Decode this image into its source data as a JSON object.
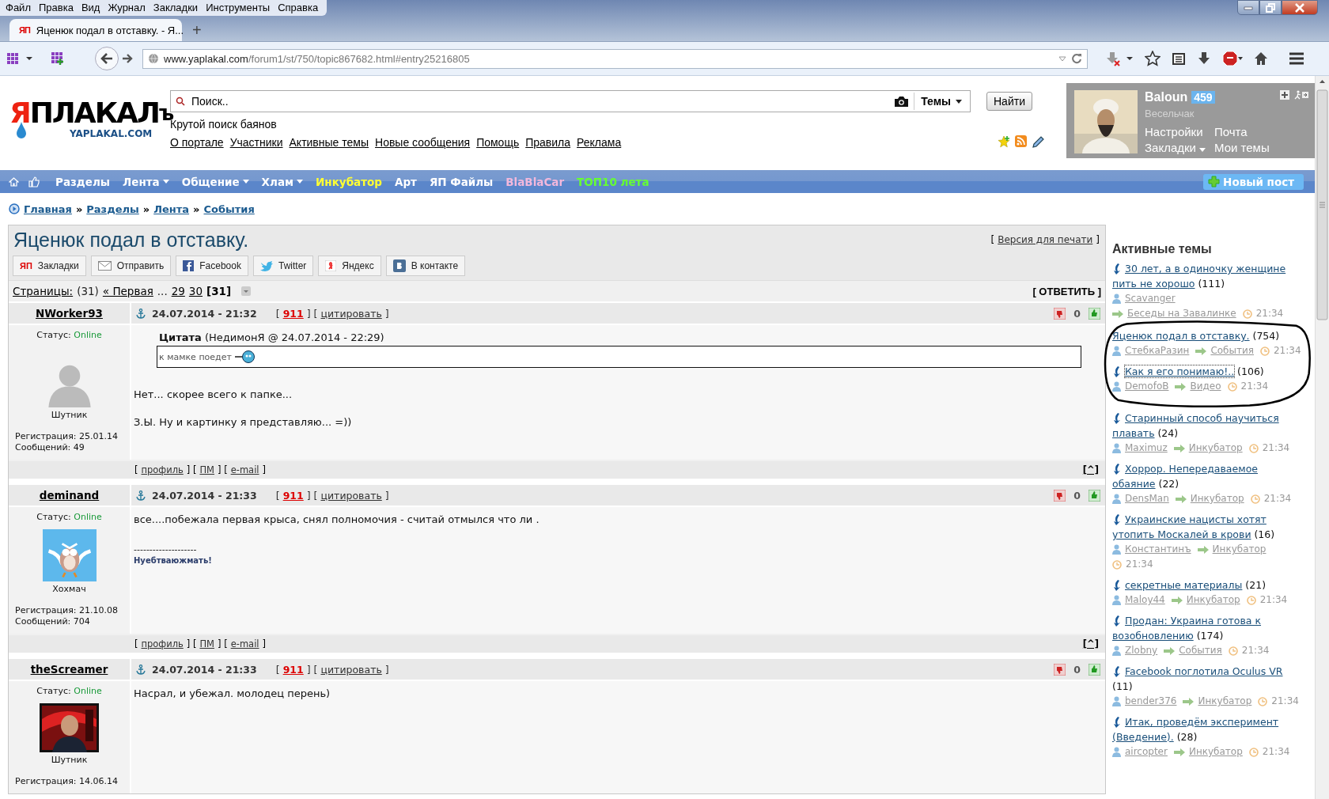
{
  "browser": {
    "menu": [
      "Файл",
      "Правка",
      "Вид",
      "Журнал",
      "Закладки",
      "Инструменты",
      "Справка"
    ],
    "tab": {
      "icon_text": "ЯП",
      "title": "Яценюк подал в отставку. - Я...",
      "new_tab": "+"
    },
    "url": {
      "host": "www.yaplakal.com",
      "path": "/forum1/st/750/topic867682.html#entry25216805"
    }
  },
  "header": {
    "logo": {
      "first": "Я",
      "rest": "ПЛАКАЛ",
      "suffix": "ъ",
      "domain": "YAPLAKAL.COM"
    },
    "search": {
      "placeholder": "Поиск..",
      "scope": "Темы",
      "button": "Найти"
    },
    "tagline": "Крутой поиск баянов",
    "links": [
      "О портале",
      "Участники",
      "Активные темы",
      "Новые сообщения",
      "Помощь",
      "Правила",
      "Реклама"
    ],
    "user": {
      "name": "Baloun",
      "karma": "459",
      "rank": "Весельчак",
      "links": [
        {
          "label": "Настройки",
          "dropdown": false
        },
        {
          "label": "Почта",
          "dropdown": false
        },
        {
          "label": "Закладки",
          "dropdown": true
        },
        {
          "label": "Мои темы",
          "dropdown": false
        }
      ]
    }
  },
  "nav": {
    "items": [
      {
        "label": "Разделы",
        "dropdown": false,
        "color": "#ffffff"
      },
      {
        "label": "Лента",
        "dropdown": true,
        "color": "#ffffff"
      },
      {
        "label": "Общение",
        "dropdown": true,
        "color": "#ffffff"
      },
      {
        "label": "Хлам",
        "dropdown": true,
        "color": "#ffffff"
      },
      {
        "label": "Инкубатор",
        "dropdown": false,
        "color": "#ffff33"
      },
      {
        "label": "Арт",
        "dropdown": false,
        "color": "#ffffff"
      },
      {
        "label": "ЯП Файлы",
        "dropdown": false,
        "color": "#ffffff"
      },
      {
        "label": "BlaBlaCar",
        "dropdown": false,
        "color": "#f2b8dc"
      },
      {
        "label": "ТОП10 лета",
        "dropdown": false,
        "color": "#66ff33"
      }
    ],
    "new_post": "Новый пост"
  },
  "breadcrumbs": [
    {
      "text": "Главная",
      "kind": "link"
    },
    {
      "text": "»",
      "kind": "plain"
    },
    {
      "text": "Разделы",
      "kind": "link"
    },
    {
      "text": "»",
      "kind": "plain"
    },
    {
      "text": "Лента",
      "kind": "link"
    },
    {
      "text": "»",
      "kind": "plain"
    },
    {
      "text": "События",
      "kind": "link"
    }
  ],
  "topic": {
    "title": "Яценюк подал в отставку.",
    "print": [
      {
        "text": "[",
        "kind": "plain"
      },
      {
        "text": "Версия для печати",
        "kind": "link"
      },
      {
        "text": "]",
        "kind": "plain"
      }
    ],
    "share": [
      {
        "kind": "bookmarks",
        "icon_text": "ЯП",
        "label": "Закладки"
      },
      {
        "kind": "mail",
        "label": "Отправить"
      },
      {
        "kind": "facebook",
        "label": "Facebook"
      },
      {
        "kind": "twitter",
        "label": "Twitter"
      },
      {
        "kind": "yandex",
        "label": "Яндекс"
      },
      {
        "kind": "vk",
        "label": "В контакте"
      }
    ],
    "pages": {
      "label": "Страницы:",
      "count": "(31)",
      "first": "« Первая",
      "gap": "...",
      "items": [
        {
          "label": "29",
          "selected": false
        },
        {
          "label": "30",
          "selected": false
        },
        {
          "label": "[31]",
          "selected": true
        }
      ]
    },
    "reply": "[ ОТВЕТИТЬ ]"
  },
  "posts": [
    {
      "author": "NWorker93",
      "date": "24.07.2014 - 21:32",
      "meta": [
        {
          "text": "[",
          "kind": "plain"
        },
        {
          "text": "911",
          "kind": "alert"
        },
        {
          "text": "] [",
          "kind": "plain"
        },
        {
          "text": "цитировать",
          "kind": "link"
        },
        {
          "text": "]",
          "kind": "plain"
        }
      ],
      "votes": "0",
      "status_label": "Статус:",
      "status": "Online",
      "avatar": {
        "kind": "placeholder"
      },
      "rank": "Шутник",
      "registration": "Регистрация: 25.01.14",
      "messages": "Сообщений: 49",
      "quote": {
        "header": "**Цитата** (НедимонЯ @ 24.07.2014 - 22:29)",
        "text": "к мамке поедет"
      },
      "body": [
        "Нет... скорее всего к папке...",
        "З.Ы. Ну и картинку я представляю... =))"
      ],
      "footer": [
        {
          "text": "[",
          "kind": "plain"
        },
        {
          "text": "профиль",
          "kind": "link"
        },
        {
          "text": "] [",
          "kind": "plain"
        },
        {
          "text": "ПМ",
          "kind": "link"
        },
        {
          "text": "] [",
          "kind": "plain"
        },
        {
          "text": "e-mail",
          "kind": "link"
        },
        {
          "text": "]",
          "kind": "plain"
        }
      ],
      "up": "[^]"
    },
    {
      "author": "deminand",
      "date": "24.07.2014 - 21:33",
      "meta": [
        {
          "text": "[",
          "kind": "plain"
        },
        {
          "text": "911",
          "kind": "alert"
        },
        {
          "text": "] [",
          "kind": "plain"
        },
        {
          "text": "цитировать",
          "kind": "link"
        },
        {
          "text": "]",
          "kind": "plain"
        }
      ],
      "votes": "0",
      "status_label": "Статус:",
      "status": "Online",
      "avatar": {
        "kind": "picture"
      },
      "rank": "Хохмач",
      "registration": "Регистрация: 21.10.08",
      "messages": "Сообщений: 704",
      "body": [
        "все....побежала первая крыса, снял полномочия - считай отмылся что ли ."
      ],
      "signature": {
        "rule": "--------------------",
        "text": "Нуебтваюжмать!"
      },
      "footer": [
        {
          "text": "[",
          "kind": "plain"
        },
        {
          "text": "профиль",
          "kind": "link"
        },
        {
          "text": "] [",
          "kind": "plain"
        },
        {
          "text": "ПМ",
          "kind": "link"
        },
        {
          "text": "] [",
          "kind": "plain"
        },
        {
          "text": "e-mail",
          "kind": "link"
        },
        {
          "text": "]",
          "kind": "plain"
        }
      ],
      "up": "[^]"
    },
    {
      "author": "theScreamer",
      "date": "24.07.2014 - 21:33",
      "meta": [
        {
          "text": "[",
          "kind": "plain"
        },
        {
          "text": "911",
          "kind": "alert"
        },
        {
          "text": "] [",
          "kind": "plain"
        },
        {
          "text": "цитировать",
          "kind": "link"
        },
        {
          "text": "]",
          "kind": "plain"
        }
      ],
      "votes": "0",
      "status_label": "Статус:",
      "status": "Online",
      "avatar": {
        "kind": "picture"
      },
      "rank": "Шутник",
      "registration": "Регистрация: 14.06.14",
      "body": [
        "Насрал, и убежал. молодец перень)"
      ]
    }
  ],
  "sidebar": {
    "title": "Активные темы",
    "topics": [
      {
        "title": "30 лет, а в одиночку женщине пить не хорошо",
        "count": "(111)",
        "author": "Scavanger",
        "section": "Беседы на Завалинке",
        "time": "21:34",
        "new": true,
        "circled": false,
        "focused": false
      },
      {
        "title": "Яценюк подал в отставку.",
        "count": "(754)",
        "author": "СтебкаРазин",
        "section": "События",
        "time": "21:34",
        "new": false,
        "circled": true,
        "focused": false
      },
      {
        "title": "Как я его понимаю!..",
        "count": "(106)",
        "author": "DemofoB",
        "section": "Видео",
        "time": "21:34",
        "new": true,
        "circled": true,
        "focused": true
      },
      {
        "title": "Старинный способ научиться плавать",
        "count": "(24)",
        "author": "Maximuz",
        "section": "Инкубатор",
        "time": "21:34",
        "new": true,
        "circled": false,
        "focused": false
      },
      {
        "title": "Хоррор. Непередаваемое обаяние",
        "count": "(22)",
        "author": "DensMan",
        "section": "Инкубатор",
        "time": "21:34",
        "new": true,
        "circled": false,
        "focused": false
      },
      {
        "title": "Украинские нацисты хотят утопить Москалей в крови",
        "count": "(16)",
        "author": "Константинъ",
        "section": "Инкубатор",
        "time": "21:34",
        "new": true,
        "circled": false,
        "focused": false
      },
      {
        "title": "секретные материалы",
        "count": "(21)",
        "author": "Maloy44",
        "section": "Инкубатор",
        "time": "21:34",
        "new": true,
        "circled": false,
        "focused": false
      },
      {
        "title": "Продан: Украина готова к возобновлению",
        "count": "(174)",
        "author": "Zlobny",
        "section": "События",
        "time": "21:34",
        "new": true,
        "circled": false,
        "focused": false
      },
      {
        "title": "Facebook поглотила Oculus VR",
        "count": "(11)",
        "author": "bender376",
        "section": "Инкубатор",
        "time": "21:34",
        "new": true,
        "circled": false,
        "focused": false
      },
      {
        "title": "Итак, проведём эксперимент (Введение).",
        "count": "(28)",
        "author": "aircopter",
        "section": "Инкубатор",
        "time": "21:34",
        "new": true,
        "circled": false,
        "focused": false
      }
    ]
  }
}
